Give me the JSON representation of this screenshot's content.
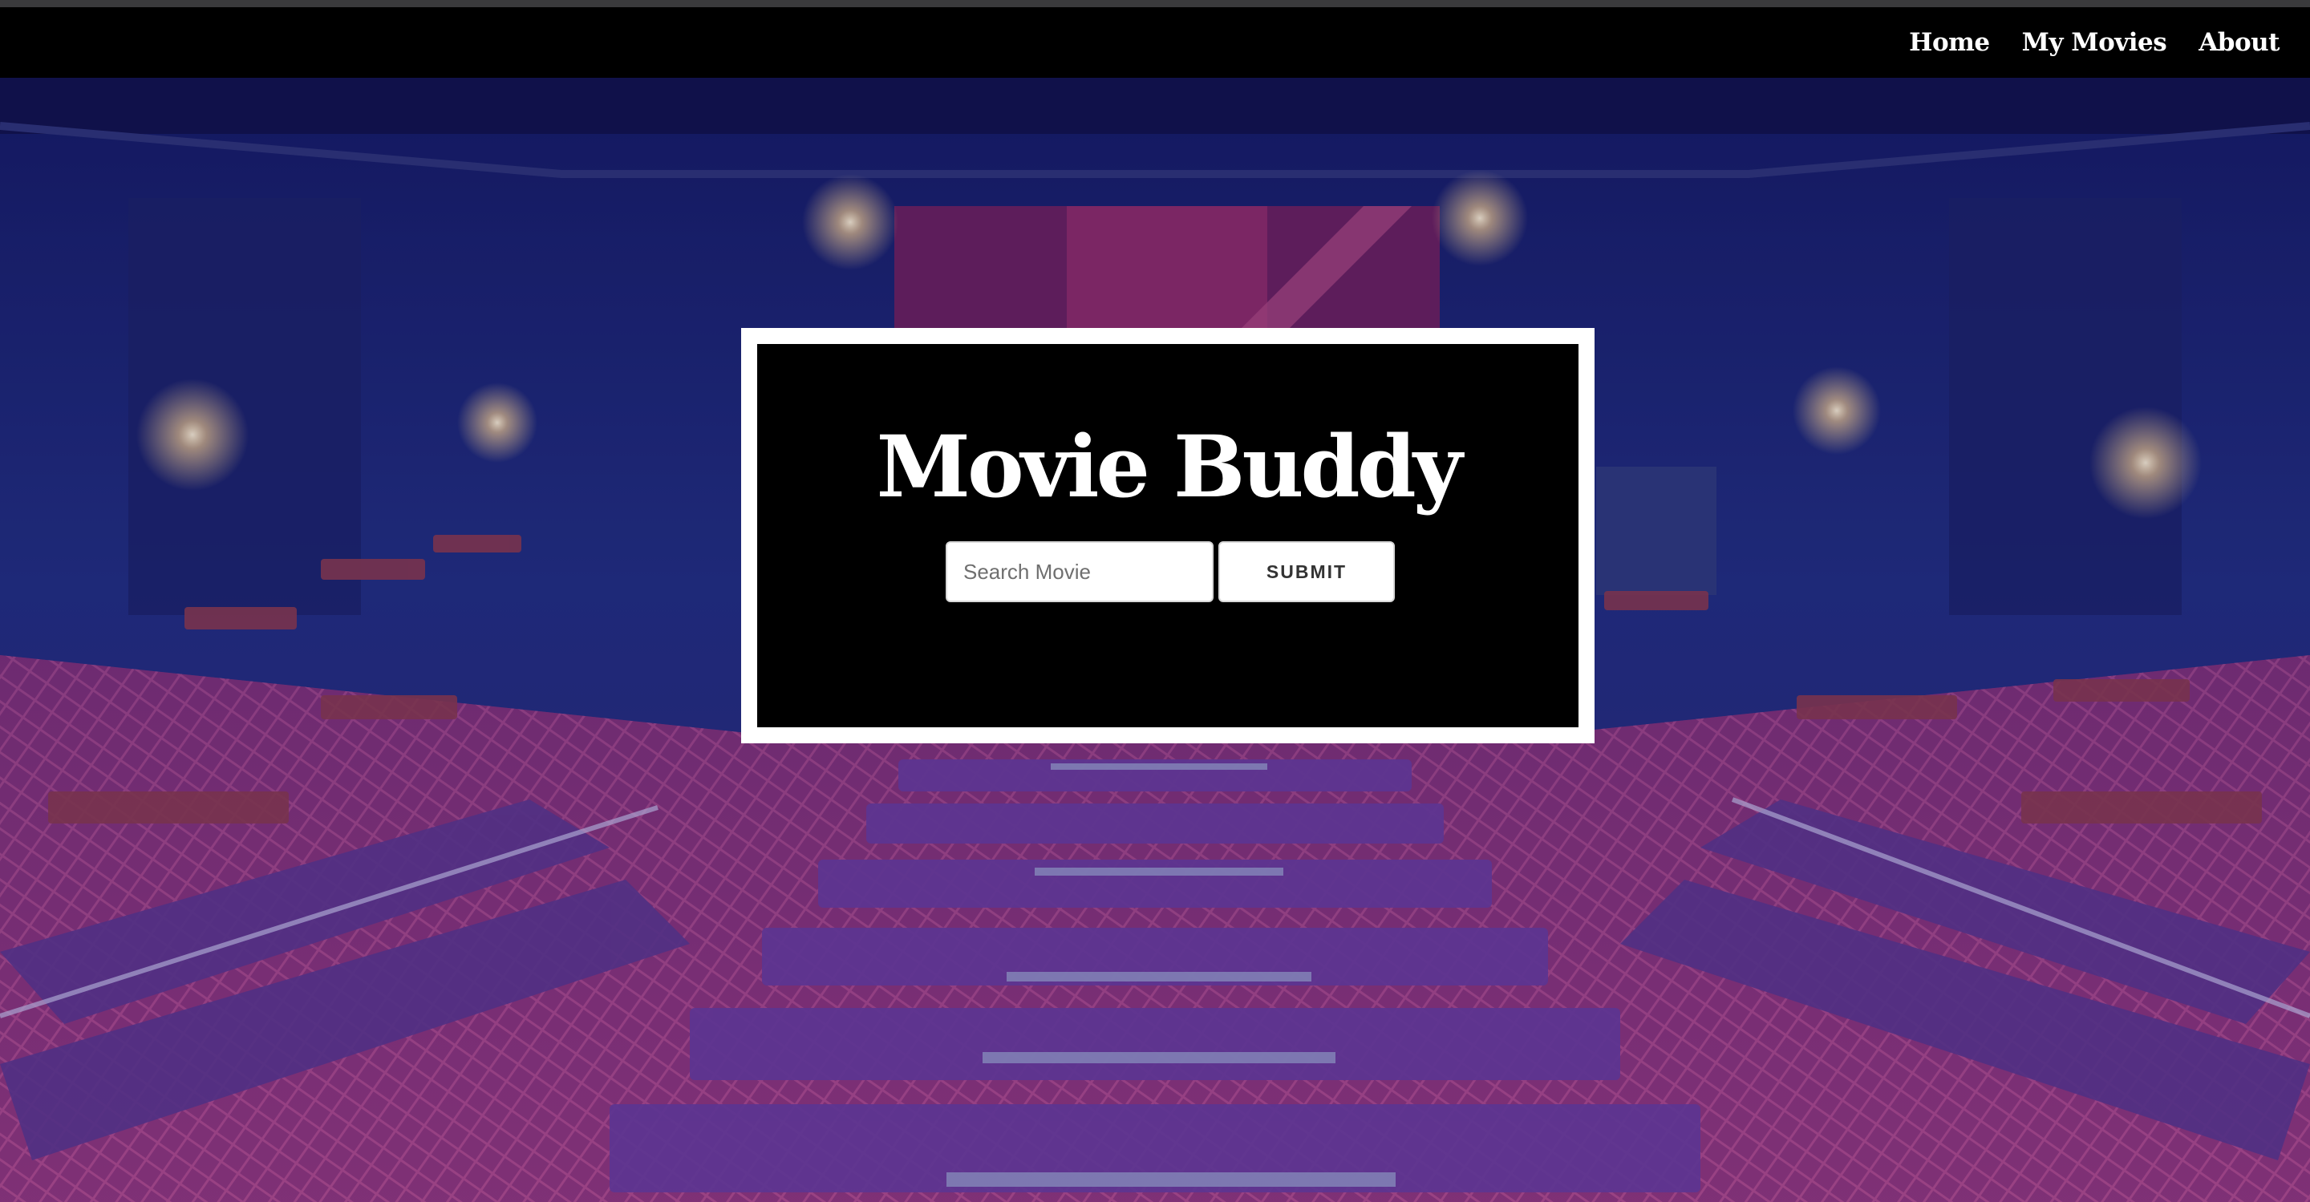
{
  "nav": {
    "items": [
      {
        "label": "Home"
      },
      {
        "label": "My Movies"
      },
      {
        "label": "About"
      }
    ]
  },
  "hero": {
    "title": "Movie Buddy",
    "search": {
      "placeholder": "Search Movie",
      "value": ""
    },
    "submit_label": "SUBMIT"
  },
  "colors": {
    "navbar": "#000000",
    "hero_frame": "#ffffff",
    "hero_inner": "#000000",
    "theater_wall": "#1c2a6e",
    "seat": "#5a3a8c",
    "carpet": "#a03a7a"
  }
}
